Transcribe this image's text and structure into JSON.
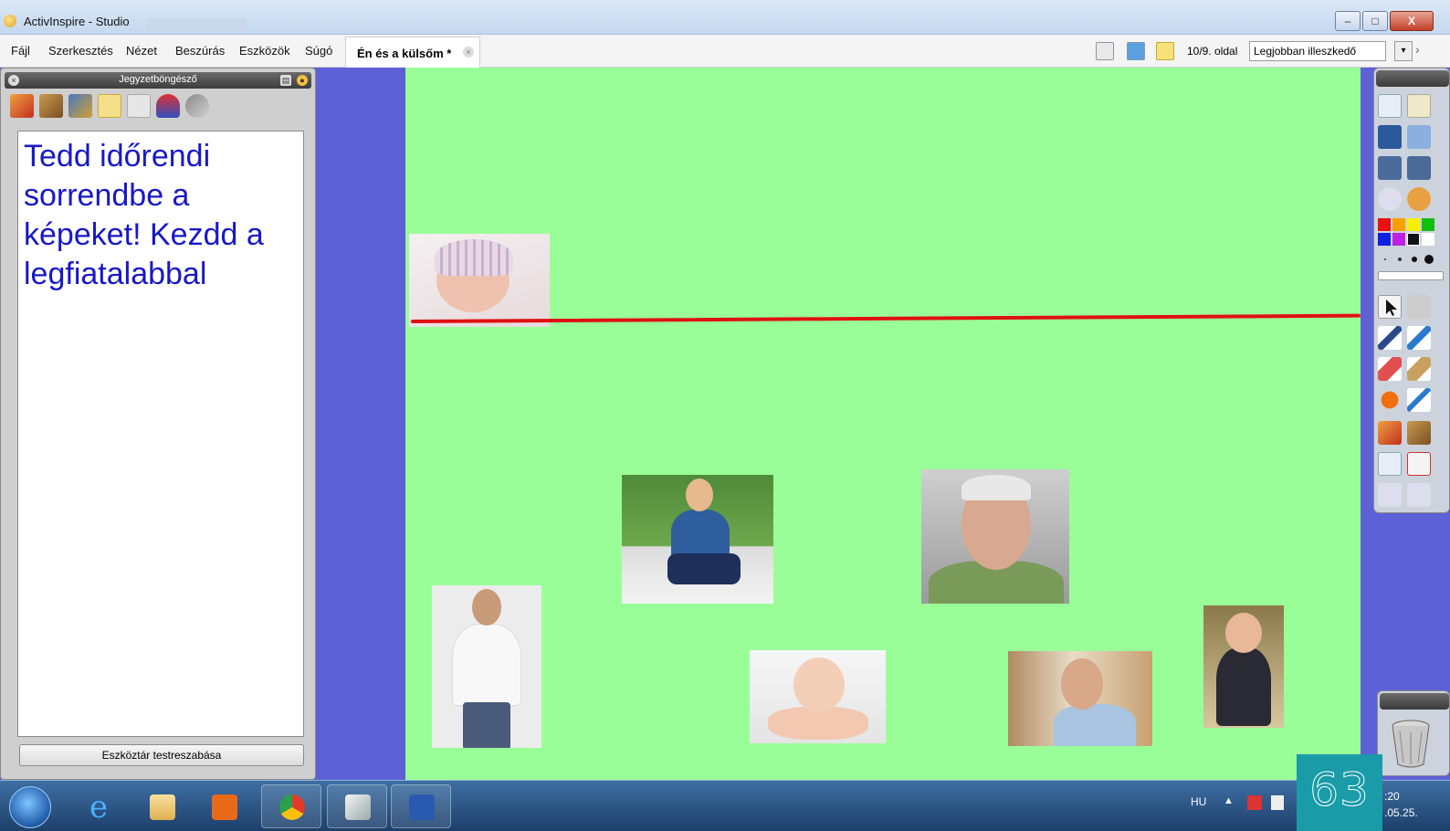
{
  "window": {
    "title": "ActivInspire - Studio",
    "minimize_label": "–",
    "maximize_label": "□",
    "close_label": "X"
  },
  "menu": {
    "items": [
      "Fájl",
      "Szerkesztés",
      "Nézet",
      "Beszúrás",
      "Eszközök",
      "Súgó"
    ]
  },
  "document_tab": {
    "label": "Én és a külsőm *",
    "close_label": "×"
  },
  "toolbar": {
    "page_indicator": "10/9. oldal",
    "fit_mode": "Legjobban illeszkedő",
    "dropdown_arrow": "▾",
    "more_arrow": "›"
  },
  "browser_panel": {
    "title": "Jegyzetböngésző",
    "close_label": "×",
    "pin_label": "▤",
    "menu_label": "●",
    "notes_text": "Tedd időrendi sorrendbe a képeket! Kezdd a legfiatalabbal",
    "customize_button": "Eszköztár testreszabása",
    "tabs": [
      "page-browser",
      "resource-browser",
      "object-browser",
      "notes-browser",
      "property-browser",
      "action-browser",
      "voting-browser"
    ]
  },
  "canvas": {
    "background": "#9afe98",
    "line_color": "#e01010",
    "photos": [
      "sleeping-newborn-photo",
      "child-sitting-photo",
      "elderly-man-photo",
      "young-man-standing-photo",
      "baby-crawling-photo",
      "adult-man-photo",
      "little-boy-suit-photo"
    ]
  },
  "right_toolbar": {
    "colors": [
      "#e81010",
      "#f7a000",
      "#f8f000",
      "#10c010",
      "#1020e0",
      "#c020e0",
      "#111111",
      "#ffffff"
    ]
  },
  "taskbar": {
    "apps": [
      "internet-explorer",
      "file-explorer",
      "media-player",
      "chrome",
      "activinspire",
      "word"
    ],
    "language": "HU",
    "tray_up": "▲",
    "clock_time": ":20",
    "clock_date": ".05.25."
  },
  "overlay": {
    "page_number": "63"
  }
}
